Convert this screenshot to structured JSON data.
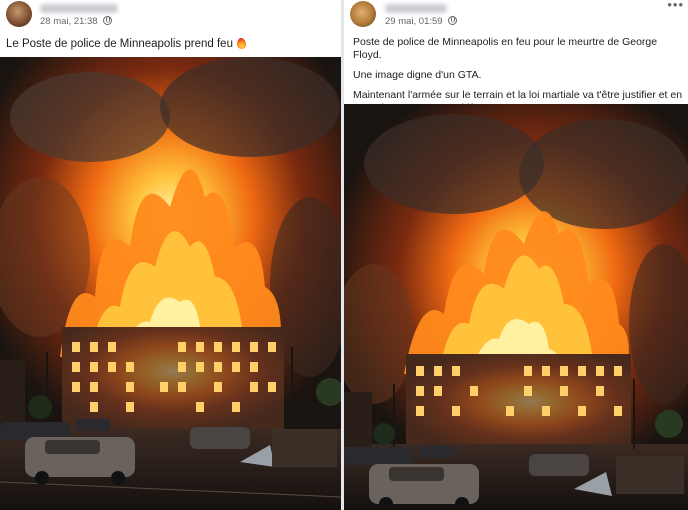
{
  "posts": [
    {
      "timestamp": "28 mai, 21:38",
      "privacy_icon": "globe-icon",
      "text": "Le Poste de police de Minneapolis prend feu",
      "emoji": "fire-emoji"
    },
    {
      "timestamp": "29 mai, 01:59",
      "privacy_icon": "globe-icon",
      "more_icon": "more-options-icon",
      "paragraphs": [
        "Poste de police de Minneapolis en feu pour le meurtre de George Floyd.",
        "Une image digne d'un GTA.",
        "Maintenant l'armée sur le terrain et la loi martiale va t'être justifier et en avant les nouveaux problèmes."
      ]
    }
  ],
  "colors": {
    "text": "#1c1e21",
    "meta": "#65676b",
    "fire": "#ff8a1c",
    "sky": "#1a1410"
  }
}
